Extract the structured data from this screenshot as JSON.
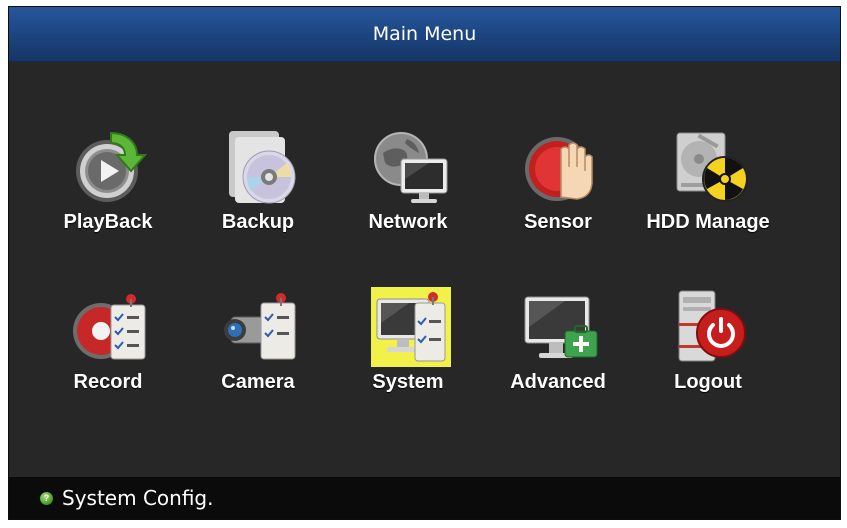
{
  "title": "Main Menu",
  "menu": {
    "row1": [
      {
        "label": "PlayBack",
        "icon": "playback-icon"
      },
      {
        "label": "Backup",
        "icon": "backup-disc-icon"
      },
      {
        "label": "Network",
        "icon": "network-globe-icon"
      },
      {
        "label": "Sensor",
        "icon": "sensor-hand-icon"
      },
      {
        "label": "HDD Manage",
        "icon": "hdd-hazard-icon"
      }
    ],
    "row2": [
      {
        "label": "Record",
        "icon": "record-checklist-icon"
      },
      {
        "label": "Camera",
        "icon": "camera-checklist-icon"
      },
      {
        "label": "System",
        "icon": "system-checklist-icon",
        "selected": true
      },
      {
        "label": "Advanced",
        "icon": "advanced-toolbox-icon"
      },
      {
        "label": "Logout",
        "icon": "logout-power-icon"
      }
    ]
  },
  "status": {
    "text": "System Config.",
    "icon": "help-dot-icon"
  },
  "colors": {
    "title_bar": "#1c447e",
    "background": "#272727",
    "selection": "#f1f14a",
    "status_bar": "#0b0b0b"
  }
}
